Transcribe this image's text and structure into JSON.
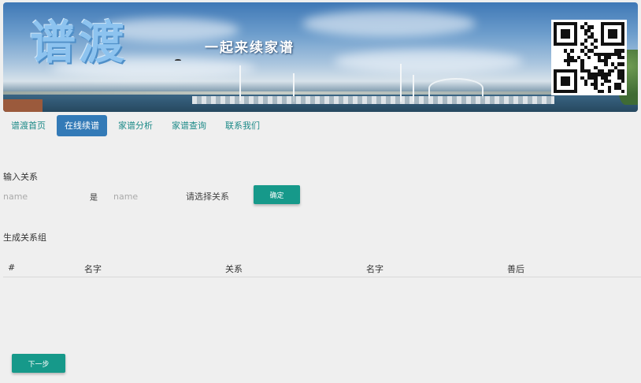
{
  "banner": {
    "logo_text": "谱渡",
    "slogan": "一起来续家谱"
  },
  "nav": {
    "items": [
      {
        "label": "谱渡首页",
        "active": false
      },
      {
        "label": "在线续谱",
        "active": true
      },
      {
        "label": "家谱分析",
        "active": false
      },
      {
        "label": "家谱查询",
        "active": false
      },
      {
        "label": "联系我们",
        "active": false
      }
    ]
  },
  "form": {
    "section_title": "输入关系",
    "name1_placeholder": "name",
    "is_label": "是",
    "name2_placeholder": "name",
    "relation_select": "请选择关系",
    "confirm_button": "确定"
  },
  "group": {
    "section_title": "生成关系组",
    "columns": [
      "#",
      "名字",
      "关系",
      "名字",
      "善后"
    ],
    "rows": []
  },
  "footer": {
    "next_button": "下一步"
  },
  "colors": {
    "accent": "#16998a",
    "nav_active": "#337ab7",
    "nav_link": "#1d8a88",
    "background": "#efefef"
  }
}
